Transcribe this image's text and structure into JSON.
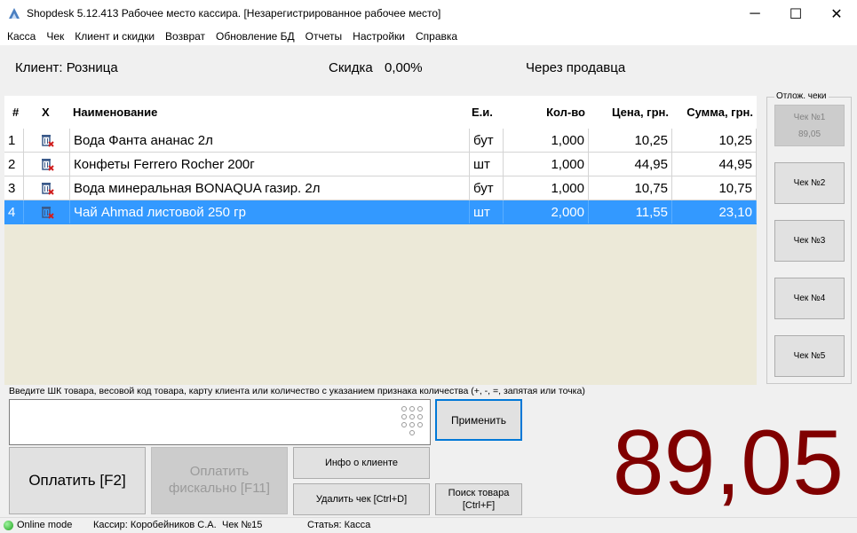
{
  "window": {
    "title": "Shopdesk 5.12.413 Рабочее место кассира. [Незарегистрированное рабочее место]",
    "minimize": "─",
    "maximize": "☐",
    "close": "✕"
  },
  "menu": [
    "Касса",
    "Чек",
    "Клиент и скидки",
    "Возврат",
    "Обновление БД",
    "Отчеты",
    "Настройки",
    "Справка"
  ],
  "info": {
    "client": "Клиент: Розница",
    "discount_label": "Скидка",
    "discount_value": "0,00%",
    "mode": "Через продавца"
  },
  "table": {
    "headers": {
      "num": "#",
      "x": "X",
      "name": "Наименование",
      "unit": "Е.и.",
      "qty": "Кол-во",
      "price": "Цена, грн.",
      "sum": "Сумма, грн."
    },
    "rows": [
      {
        "num": "1",
        "name": "Вода Фанта ананас 2л",
        "unit": "бут",
        "qty": "1,000",
        "price": "10,25",
        "sum": "10,25"
      },
      {
        "num": "2",
        "name": "Конфеты Ferrero Rocher 200г",
        "unit": "шт",
        "qty": "1,000",
        "price": "44,95",
        "sum": "44,95"
      },
      {
        "num": "3",
        "name": "Вода минеральная BONAQUA газир. 2л",
        "unit": "бут",
        "qty": "1,000",
        "price": "10,75",
        "sum": "10,75"
      },
      {
        "num": "4",
        "name": "Чай Ahmad листовой 250 гр",
        "unit": "шт",
        "qty": "2,000",
        "price": "11,55",
        "sum": "23,10"
      }
    ],
    "selected_row": 4
  },
  "deferred": {
    "title": "Отлож. чеки",
    "checks": [
      {
        "label": "Чек №1",
        "amount": "89,05"
      },
      {
        "label": "Чек №2",
        "amount": ""
      },
      {
        "label": "Чек №3",
        "amount": ""
      },
      {
        "label": "Чек №4",
        "amount": ""
      },
      {
        "label": "Чек №5",
        "amount": ""
      }
    ]
  },
  "input": {
    "hint": "Введите ШК товара, весовой код товара,  карту клиента или количество с указанием признака количества (+, -, =, запятая или точка)",
    "value": ""
  },
  "buttons": {
    "apply": "Применить",
    "pay": "Оплатить [F2]",
    "pay_fiscal_line1": "Оплатить",
    "pay_fiscal_line2": "фискально [F11]",
    "client_info": "Инфо о клиенте",
    "delete_check": "Удалить чек [Ctrl+D]",
    "search_line1": "Поиск товара",
    "search_line2": "[Ctrl+F]"
  },
  "total": "89,05",
  "status": {
    "mode": "Online mode",
    "cashier": "Кассир: Коробейников С.А.",
    "check": "Чек №15",
    "article": "Статья: Касса"
  },
  "colors": {
    "selection": "#3399ff",
    "total": "#800000",
    "online": "#1ea01e"
  }
}
